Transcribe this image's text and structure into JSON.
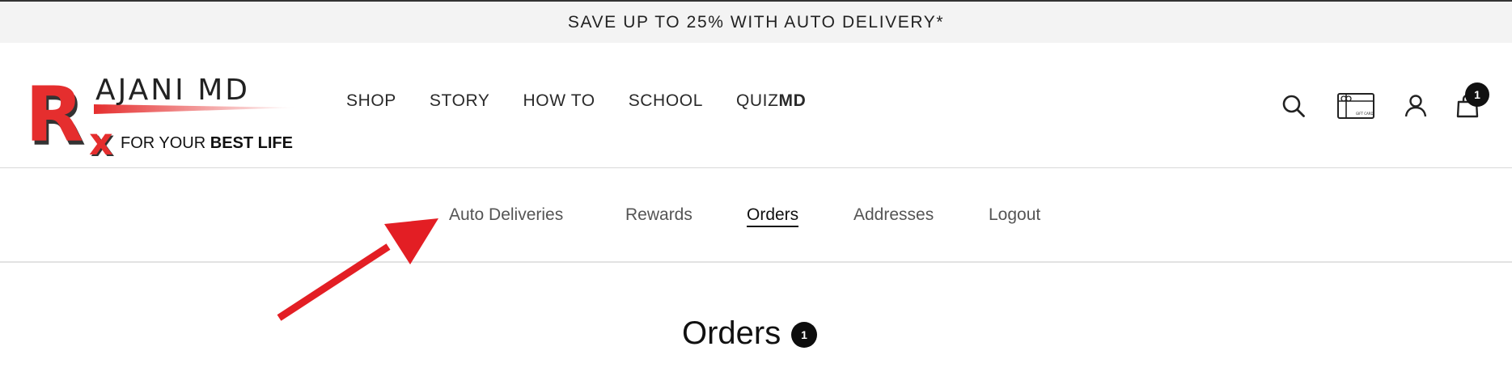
{
  "announcement": {
    "text": "SAVE UP TO 25% WITH AUTO DELIVERY*"
  },
  "logo": {
    "letters": "R",
    "subscript": "x",
    "brand": "AJANI MD",
    "tagline_regular": "FOR YOUR ",
    "tagline_bold": "BEST LIFE"
  },
  "main_nav": {
    "shop": "SHOP",
    "story": "STORY",
    "how_to": "HOW TO",
    "school": "SCHOOL",
    "quiz_regular": "QUIZ",
    "quiz_bold": "MD"
  },
  "header_icons": {
    "search": "search-icon",
    "gift_card": "gift-card-icon",
    "gift_card_label": "GIFT CARD",
    "account": "user-icon",
    "cart": "shopping-bag-icon",
    "cart_count": "1"
  },
  "account_nav": {
    "tabs": [
      {
        "label": "Auto Deliveries",
        "active": false
      },
      {
        "label": "Rewards",
        "active": false
      },
      {
        "label": "Orders",
        "active": true
      },
      {
        "label": "Addresses",
        "active": false
      },
      {
        "label": "Logout",
        "active": false
      }
    ]
  },
  "annotation": {
    "arrow_color": "#e31e24"
  },
  "main": {
    "heading": "Orders",
    "heading_count": "1"
  },
  "colors": {
    "brand_red": "#e52e2e",
    "announcement_bg": "#f3f3f3",
    "text_dark": "#1f1f1f",
    "badge_bg": "#111111"
  }
}
